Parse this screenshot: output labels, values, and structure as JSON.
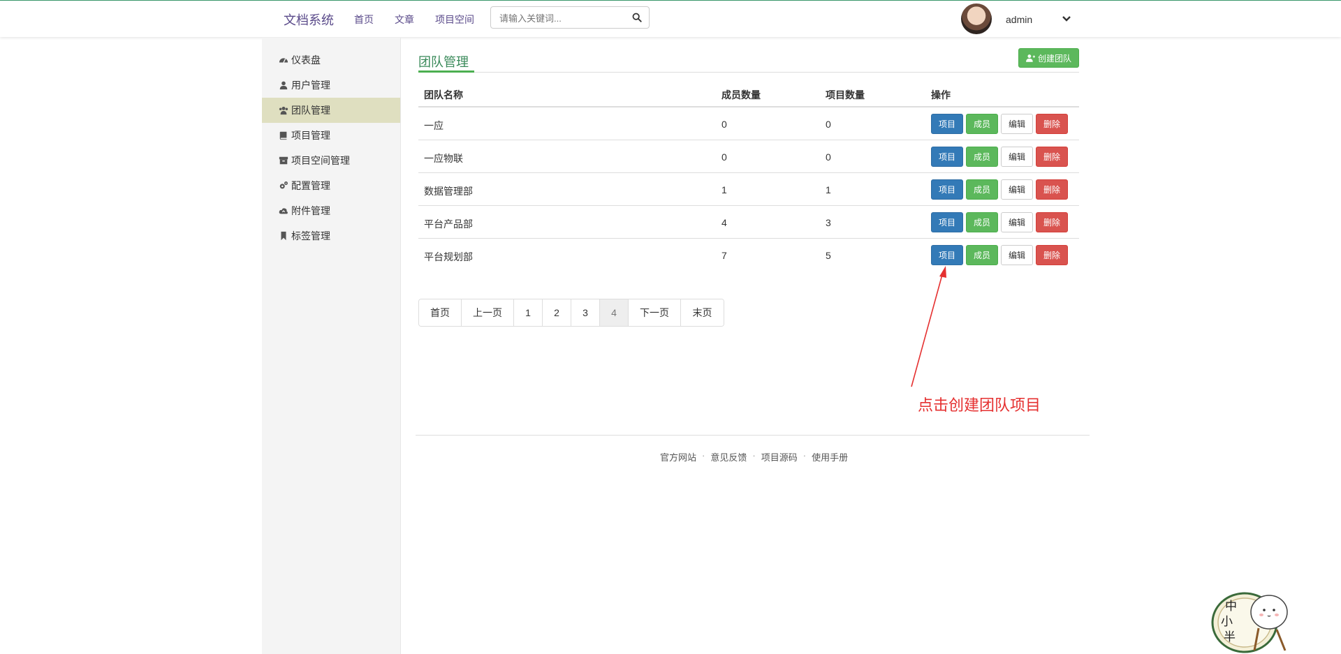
{
  "header": {
    "brand": "文档系统",
    "nav": [
      "首页",
      "文章",
      "项目空间"
    ],
    "search_placeholder": "请输入关键词...",
    "username": "admin"
  },
  "sidebar": {
    "items": [
      {
        "label": "仪表盘",
        "icon": "dashboard-icon"
      },
      {
        "label": "用户管理",
        "icon": "user-icon"
      },
      {
        "label": "团队管理",
        "icon": "users-icon",
        "active": true
      },
      {
        "label": "项目管理",
        "icon": "book-icon"
      },
      {
        "label": "项目空间管理",
        "icon": "archive-icon"
      },
      {
        "label": "配置管理",
        "icon": "cogs-icon"
      },
      {
        "label": "附件管理",
        "icon": "cloud-upload-icon"
      },
      {
        "label": "标签管理",
        "icon": "bookmark-icon"
      }
    ]
  },
  "main": {
    "title": "团队管理",
    "create_button": "创建团队",
    "columns": [
      "团队名称",
      "成员数量",
      "项目数量",
      "操作"
    ],
    "rows": [
      {
        "name": "一应",
        "members": "0",
        "projects": "0"
      },
      {
        "name": "一应物联",
        "members": "0",
        "projects": "0"
      },
      {
        "name": "数据管理部",
        "members": "1",
        "projects": "1"
      },
      {
        "name": "平台产品部",
        "members": "4",
        "projects": "3"
      },
      {
        "name": "平台规划部",
        "members": "7",
        "projects": "5"
      }
    ],
    "actions": {
      "project": "项目",
      "member": "成员",
      "edit": "编辑",
      "delete": "删除"
    },
    "pagination": {
      "first": "首页",
      "prev": "上一页",
      "pages": [
        "1",
        "2",
        "3",
        "4"
      ],
      "current": "4",
      "next": "下一页",
      "last": "末页"
    }
  },
  "annotation": "点击创建团队项目",
  "footer": [
    "官方网站",
    "意见反馈",
    "项目源码",
    "使用手册"
  ],
  "mascot_text": "中小半",
  "colors": {
    "primary": "#337ab7",
    "success": "#5cb85c",
    "danger": "#d9534f",
    "active_sidebar": "#dfdfc0",
    "annotation": "#e53030"
  }
}
